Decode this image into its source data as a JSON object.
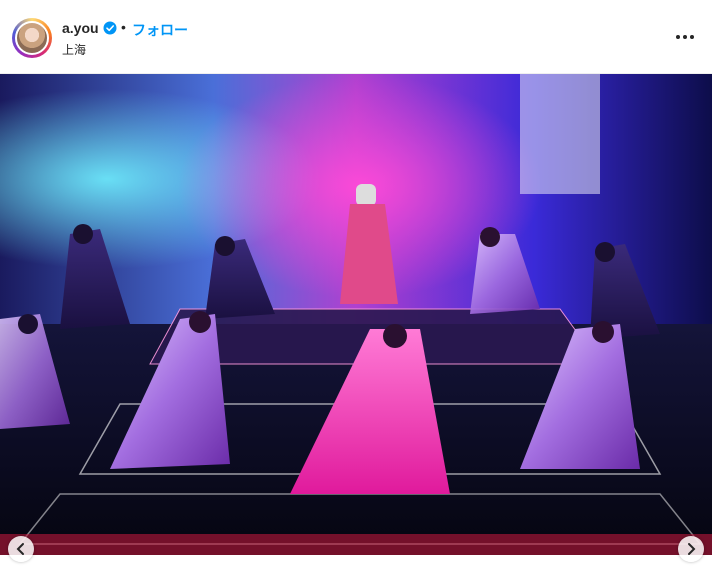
{
  "post": {
    "username": "a.you",
    "separator": "•",
    "follow_label": "フォロー",
    "location": "上海"
  },
  "icons": {
    "verified": "verified-badge-icon",
    "more": "more-options-icon",
    "prev": "chevron-left-icon",
    "next": "chevron-right-icon"
  },
  "colors": {
    "accent": "#0095f6",
    "verified": "#0095f6",
    "text": "#262626"
  }
}
